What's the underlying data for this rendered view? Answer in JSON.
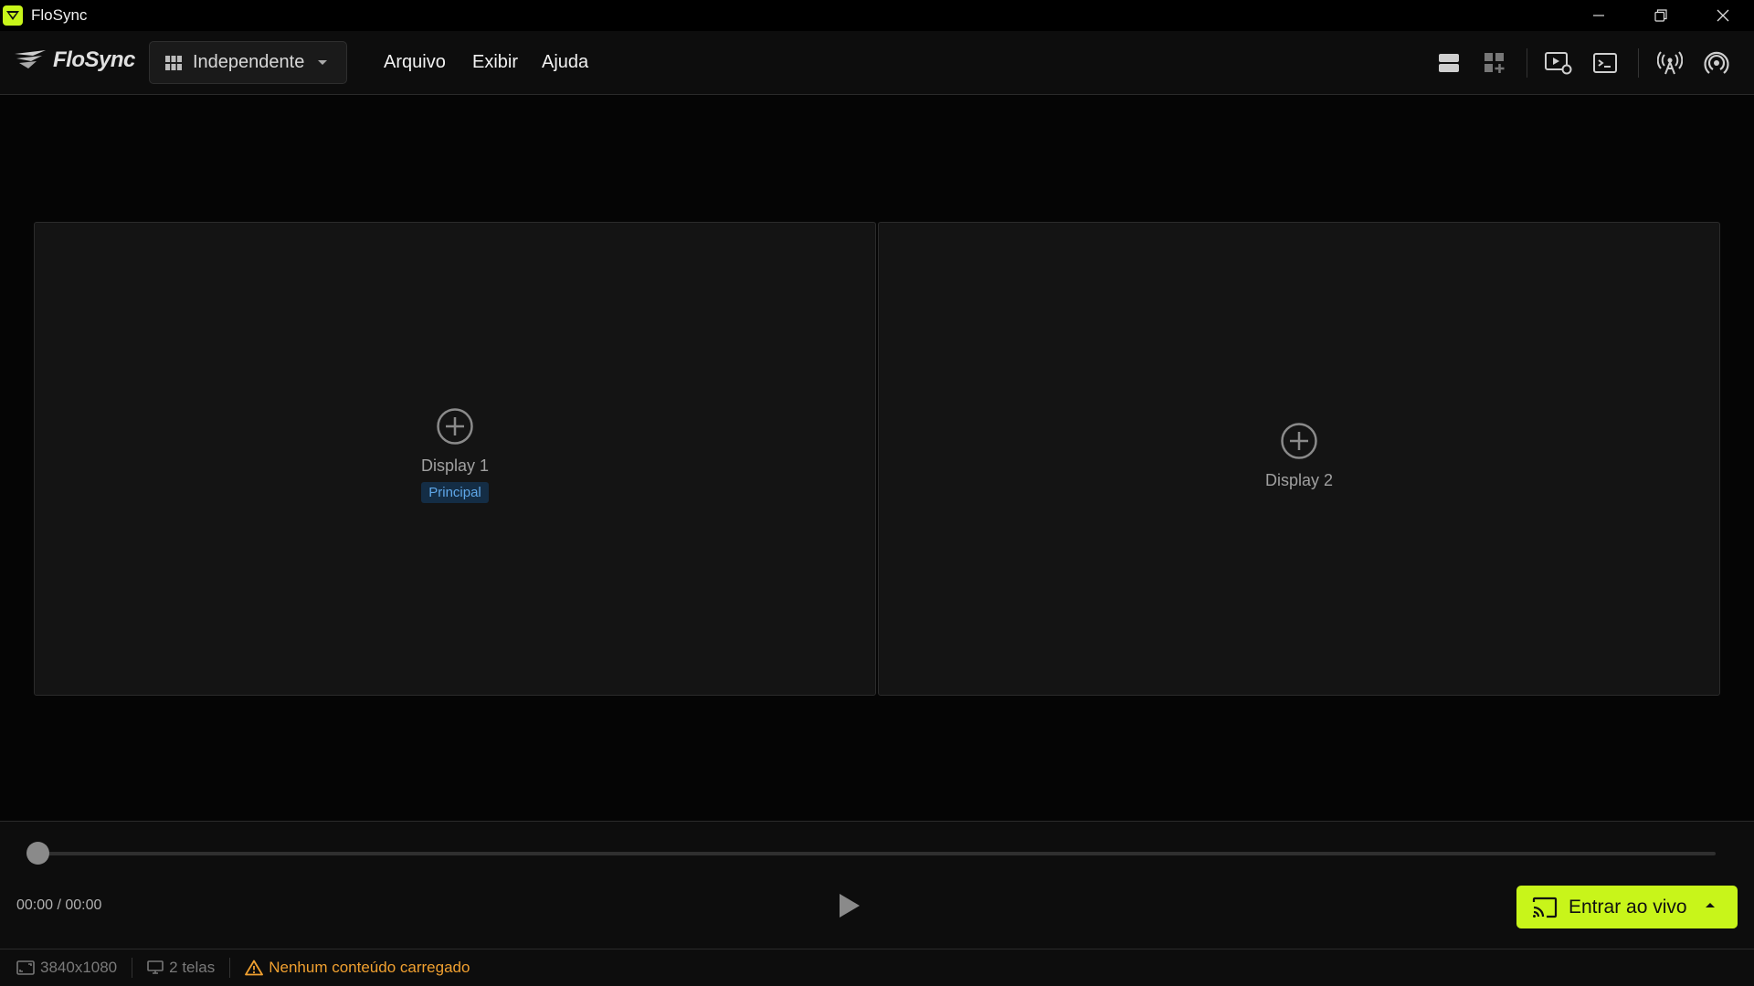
{
  "window": {
    "title": "FloSync"
  },
  "menubar": {
    "logo_text": "FloSync",
    "mode_select": {
      "value": "Independente"
    },
    "menu": [
      {
        "label": "Arquivo"
      },
      {
        "label": "Exibir"
      },
      {
        "label": "Ajuda"
      }
    ],
    "tools": [
      "layout-list-icon",
      "layout-grid-add-icon",
      "media-settings-icon",
      "terminal-icon",
      "broadcast-antenna-icon",
      "signal-receiver-icon"
    ]
  },
  "displays": [
    {
      "label": "Display 1",
      "badge": "Principal"
    },
    {
      "label": "Display 2",
      "badge": ""
    }
  ],
  "playback": {
    "time": "00:00 / 00:00",
    "progress": 0,
    "live_button": "Entrar ao vivo"
  },
  "status": {
    "resolution": "3840x1080",
    "screens": "2 telas",
    "warning": "Nenhum conteúdo carregado"
  },
  "colors": {
    "accent": "#c8f51a",
    "badge_bg": "#142d45",
    "badge_text": "#5fa7e8",
    "warning": "#f0a030"
  }
}
